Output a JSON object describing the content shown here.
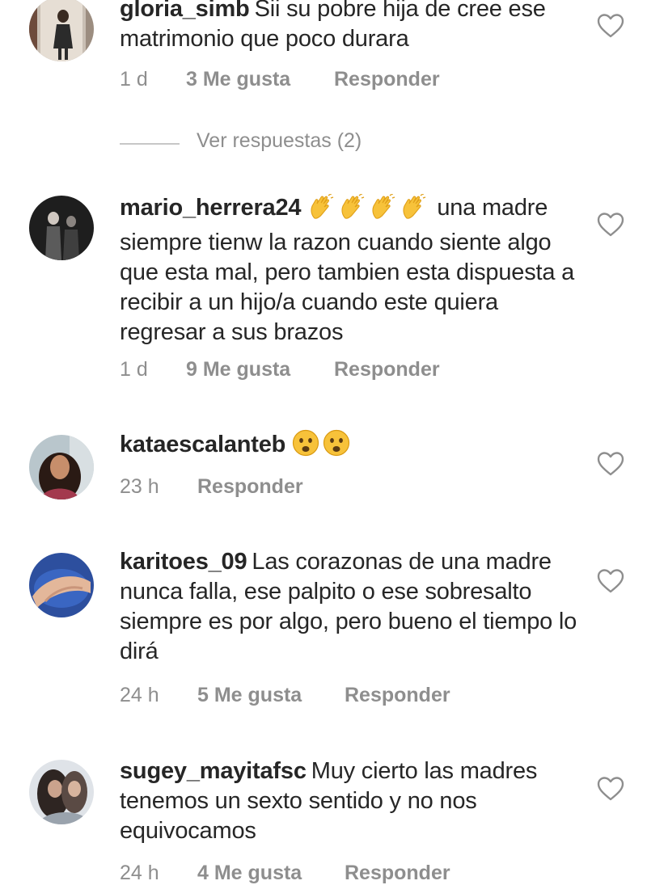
{
  "view_replies_label": "Ver respuestas (2)",
  "comments": [
    {
      "username": "gloria_simb",
      "text": "Sii su pobre hija de cree ese matrimonio que poco durara",
      "time": "1 d",
      "likes": "3 Me gusta",
      "reply": "Responder"
    },
    {
      "username": "mario_herrera24",
      "emoji": "clapping-hands x4",
      "text": "una madre siempre tienw la razon cuando siente algo que esta mal, pero tambien esta dispuesta a recibir a un hijo/a cuando este quiera regresar a sus brazos",
      "time": "1 d",
      "likes": "9 Me gusta",
      "reply": "Responder"
    },
    {
      "username": "kataescalanteb",
      "emoji": "frowning-face x2",
      "text": "",
      "time": "23 h",
      "reply": "Responder"
    },
    {
      "username": "karitoes_09",
      "text": "Las corazonas de una madre nunca falla, ese palpito o ese sobresalto siempre es por algo, pero bueno el tiempo lo dirá",
      "time": "24 h",
      "likes": "5 Me gusta",
      "reply": "Responder"
    },
    {
      "username": "sugey_mayitafsc",
      "text": "Muy cierto las madres tenemos un sexto sentido y no nos equivocamos",
      "time": "24 h",
      "likes": "4 Me gusta",
      "reply": "Responder"
    }
  ],
  "colors": {
    "text": "#262626",
    "meta": "#8e8e8e",
    "emoji": "#f5c518"
  }
}
